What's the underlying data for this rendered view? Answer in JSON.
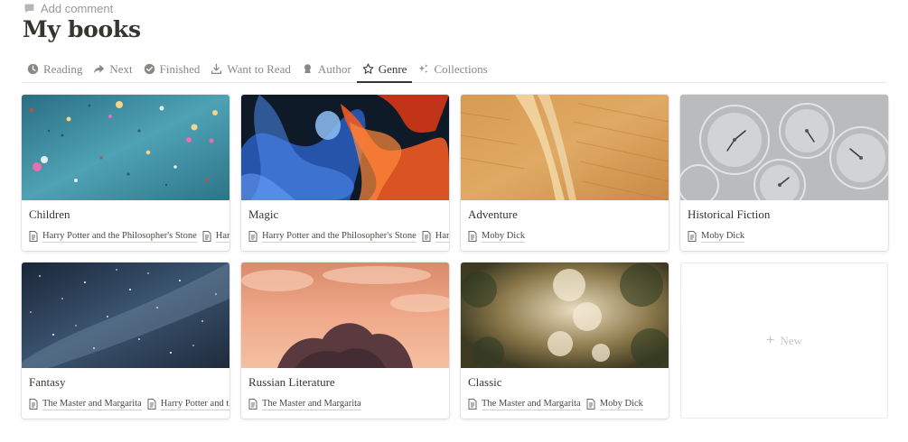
{
  "comment": {
    "label": "Add comment"
  },
  "page": {
    "title": "My books"
  },
  "tabs": [
    {
      "label": "Reading",
      "icon": "clock-icon"
    },
    {
      "label": "Next",
      "icon": "arrow-forward-icon"
    },
    {
      "label": "Finished",
      "icon": "check-circle-icon"
    },
    {
      "label": "Want to Read",
      "icon": "download-icon"
    },
    {
      "label": "Author",
      "icon": "person-icon"
    },
    {
      "label": "Genre",
      "icon": "star-icon",
      "active": true
    },
    {
      "label": "Collections",
      "icon": "sparkle-icon"
    }
  ],
  "cards": [
    {
      "title": "Children",
      "cover": "confetti",
      "books": [
        "Harry Potter and the Philosopher's Stone",
        "Harry Potter and the Chamber of Secrets"
      ]
    },
    {
      "title": "Magic",
      "cover": "smoke",
      "books": [
        "Harry Potter and the Philosopher's Stone",
        "Harry Potter and the Chamber of Secrets"
      ]
    },
    {
      "title": "Adventure",
      "cover": "sand",
      "books": [
        "Moby Dick"
      ]
    },
    {
      "title": "Historical Fiction",
      "cover": "clocks",
      "books": [
        "Moby Dick"
      ]
    },
    {
      "title": "Fantasy",
      "cover": "stars",
      "books": [
        "The Master and Margarita",
        "Harry Potter and the Philosopher's Stone"
      ]
    },
    {
      "title": "Russian Literature",
      "cover": "sunset",
      "books": [
        "The Master and Margarita"
      ]
    },
    {
      "title": "Classic",
      "cover": "bokeh",
      "books": [
        "The Master and Margarita",
        "Moby Dick"
      ]
    }
  ],
  "new_card": {
    "label": "New"
  }
}
